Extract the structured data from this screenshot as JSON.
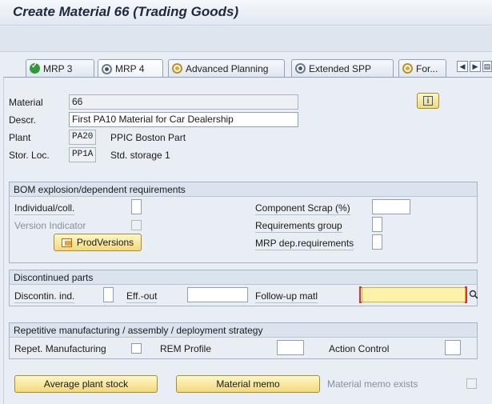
{
  "window": {
    "title": "Create Material 66 (Trading Goods)"
  },
  "tabs": [
    {
      "label": "MRP 3",
      "icon": "check-icon"
    },
    {
      "label": "MRP 4",
      "icon": "status-icon",
      "active": true
    },
    {
      "label": "Advanced Planning",
      "icon": "status-icon"
    },
    {
      "label": "Extended SPP",
      "icon": "status-icon"
    },
    {
      "label": "For...",
      "icon": "status-icon"
    }
  ],
  "header": {
    "material_label": "Material",
    "material_value": "66",
    "descr_label": "Descr.",
    "descr_value": "First PA10 Material for Car Dealership",
    "plant_label": "Plant",
    "plant_code": "PA20",
    "plant_name": "PPIC Boston Part",
    "storloc_label": "Stor. Loc.",
    "storloc_code": "PP1A",
    "storloc_name": "Std. storage 1"
  },
  "bom": {
    "title": "BOM explosion/dependent requirements",
    "individual_label": "Individual/coll.",
    "individual_value": "",
    "version_indicator_label": "Version Indicator",
    "prodversions_label": "ProdVersions",
    "component_scrap_label": "Component Scrap (%)",
    "component_scrap_value": "",
    "requirements_group_label": "Requirements group",
    "requirements_group_value": "",
    "mrp_dep_label": "MRP dep.requirements",
    "mrp_dep_value": ""
  },
  "discontinued": {
    "title": "Discontinued parts",
    "discontin_label": "Discontin. ind.",
    "discontin_value": "",
    "eff_out_label": "Eff.-out",
    "eff_out_value": "",
    "followup_label": "Follow-up matl",
    "followup_value": ""
  },
  "repetitive": {
    "title": "Repetitive manufacturing / assembly / deployment strategy",
    "repet_label": "Repet. Manufacturing",
    "rem_profile_label": "REM Profile",
    "rem_profile_value": "",
    "action_control_label": "Action Control",
    "action_control_value": ""
  },
  "footer": {
    "avg_plant_stock_label": "Average plant stock",
    "material_memo_label": "Material memo",
    "memo_exists_label": "Material memo exists"
  },
  "colors": {
    "button_fill": "#f1d97a",
    "required_field": "#fdf3a8",
    "required_mark": "#d9312b"
  }
}
